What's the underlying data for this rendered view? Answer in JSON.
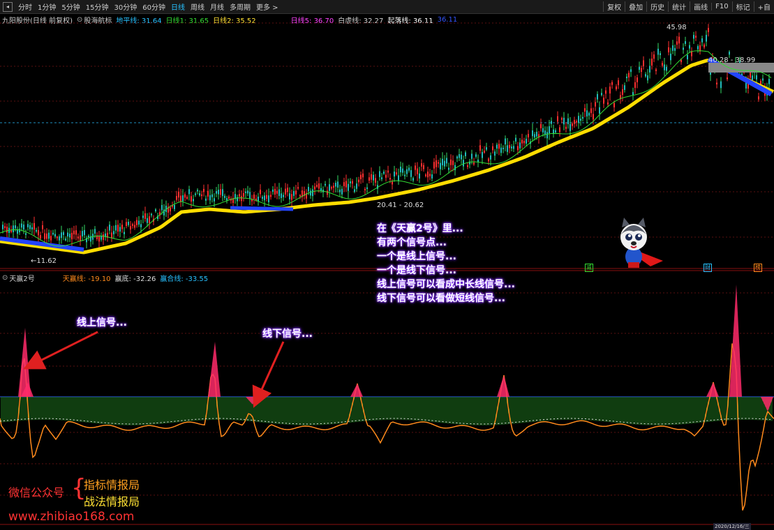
{
  "toolbar": {
    "back": "◂",
    "periods": [
      "分时",
      "1分钟",
      "5分钟",
      "15分钟",
      "30分钟",
      "60分钟",
      "日线",
      "周线",
      "月线",
      "多周期",
      "更多 >"
    ],
    "active_period": "日线",
    "right": [
      "复权",
      "叠加",
      "历史",
      "统计",
      "画线",
      "F10",
      "标记",
      "+自"
    ]
  },
  "main_legend": {
    "stock": "九阳股份(日线 前复权)",
    "indicator": "股海航标",
    "items": [
      {
        "label": "地平线: 31.64",
        "color": "#27c1ff"
      },
      {
        "label": "日线1: 31.65",
        "color": "#33dd33"
      },
      {
        "label": "日线2: 35.52",
        "color": "#ffe033"
      },
      {
        "label": "日线5: 36.70",
        "color": "#ff44ff"
      },
      {
        "label": "白虚线: 32.27",
        "color": "#cfcfcf"
      },
      {
        "label": "起落线: 36.11",
        "color": "#ffffff"
      },
      {
        "label": "36.11",
        "color": "#3355ff"
      }
    ]
  },
  "price_labels": {
    "high": "45.98",
    "low": "11.62",
    "mid": "20.41 - 20.62",
    "right_range": "40.28 - 38.99"
  },
  "sub_legend": {
    "name": "天赢2号",
    "items": [
      {
        "label": "天赢线: -19.10",
        "color": "#ff8a1c"
      },
      {
        "label": "赢底: -32.26",
        "color": "#dddddd"
      },
      {
        "label": "赢合线: -33.55",
        "color": "#27c1ff"
      }
    ]
  },
  "marker_tags": [
    {
      "text": "减",
      "color": "#33dd33"
    },
    {
      "text": "财",
      "color": "#27c1ff"
    },
    {
      "text": "榜",
      "color": "#ff8a1c"
    }
  ],
  "annotations": {
    "intro_lines": [
      "在《天赢2号》里...",
      "有两个信号点...",
      "一个是线上信号...",
      "一个是线下信号...",
      "线上信号可以看成中长线信号...",
      "线下信号可以看做短线信号..."
    ],
    "signal_above": "线上信号...",
    "signal_below": "线下信号..."
  },
  "watermark": {
    "wechat": "微信公众号",
    "brace": "{",
    "line1": "指标情报局",
    "line2": "战法情报局",
    "url": "www.zhibiao168.com"
  },
  "bottom_date": "2020/12/16/三"
}
